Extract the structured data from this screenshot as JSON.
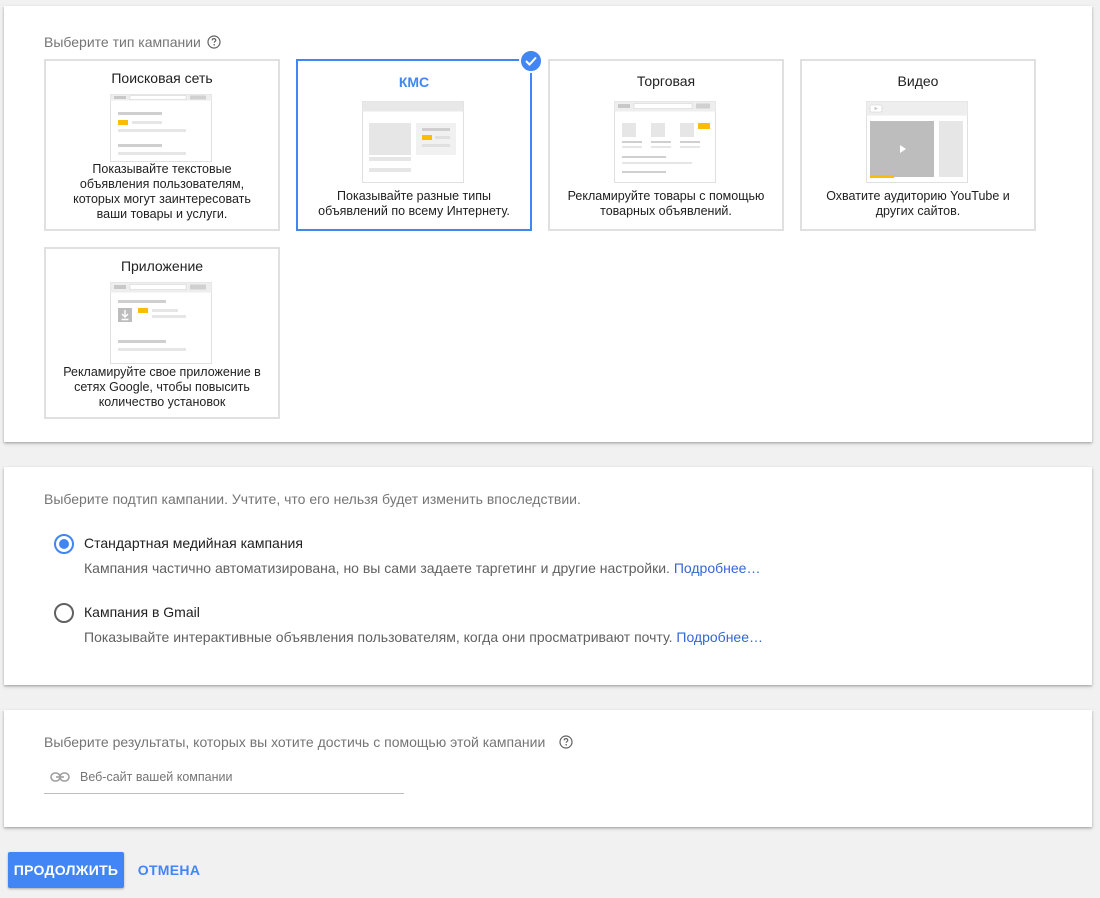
{
  "campaign_type": {
    "label": "Выберите тип кампании",
    "cards": [
      {
        "title": "Поисковая сеть",
        "description": [
          "Показывайте текстовые",
          "объявления пользователям,",
          "которых могут заинтересовать",
          "ваши товары и услуги."
        ],
        "selected": false,
        "illustration": "search-network-illustration"
      },
      {
        "title": "КМС",
        "description": [
          "Показывайте разные типы",
          "объявлений по всему Интернету."
        ],
        "selected": true,
        "illustration": "display-network-illustration"
      },
      {
        "title": "Торговая",
        "description": [
          "Рекламируйте товары с помощью",
          "товарных объявлений."
        ],
        "selected": false,
        "illustration": "shopping-illustration"
      },
      {
        "title": "Видео",
        "description": [
          "Охватите аудиторию YouTube и",
          "других сайтов."
        ],
        "selected": false,
        "illustration": "video-illustration"
      },
      {
        "title": "Приложение",
        "description": [
          "Рекламируйте свое приложение в",
          "сетях Google, чтобы повысить",
          "количество установок"
        ],
        "selected": false,
        "illustration": "app-illustration"
      }
    ]
  },
  "campaign_subtype": {
    "label": "Выберите подтип кампании. Учтите, что его нельзя будет изменить впоследствии.",
    "options": [
      {
        "title": "Стандартная медийная кампания",
        "description": "Кампания частично автоматизирована, но вы сами задаете таргетинг и другие настройки.",
        "link": "Подробнее…",
        "checked": true
      },
      {
        "title": "Кампания в Gmail",
        "description": "Показывайте интерактивные объявления пользователям, когда они просматривают почту.",
        "link": "Подробнее…",
        "checked": false
      }
    ]
  },
  "goals": {
    "label": "Выберите результаты, которых вы хотите достичь с помощью этой кампании",
    "website_placeholder": "Веб-сайт вашей компании",
    "website_value": ""
  },
  "actions": {
    "continue": "ПРОДОЛЖИТЬ",
    "cancel": "ОТМЕНА"
  },
  "colors": {
    "accent": "#4285f4",
    "link": "#3367d6",
    "highlight": "#fbbc04"
  }
}
